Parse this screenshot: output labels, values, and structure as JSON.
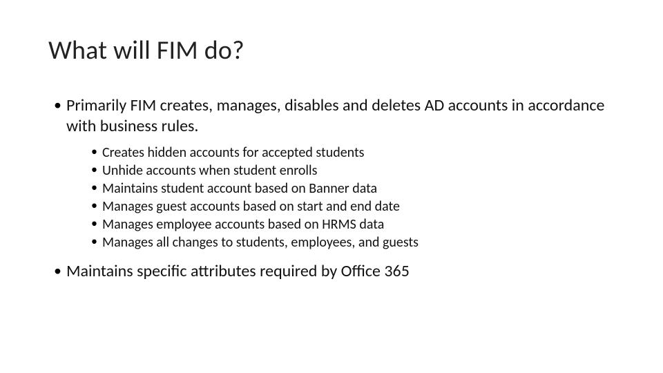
{
  "title": "What will FIM do?",
  "bullets": [
    {
      "text": "Primarily FIM creates, manages, disables and deletes AD accounts in accordance with business rules.",
      "sub": [
        "Creates hidden accounts for accepted students",
        "Unhide accounts when student enrolls",
        "Maintains student account based on Banner data",
        "Manages guest accounts based on start and end date",
        "Manages employee accounts based on HRMS data",
        "Manages all changes to students, employees, and guests"
      ]
    },
    {
      "text": "Maintains specific attributes required by Office 365",
      "sub": []
    }
  ]
}
